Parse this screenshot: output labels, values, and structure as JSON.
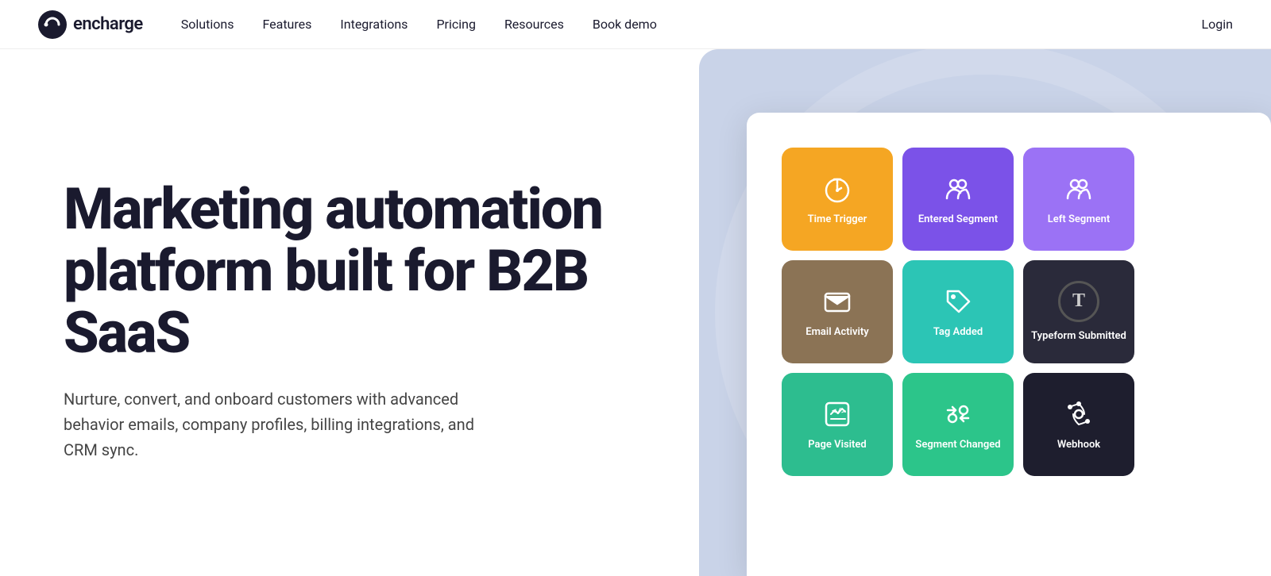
{
  "nav": {
    "logo_text": "encharge",
    "links": [
      {
        "label": "Solutions",
        "id": "solutions"
      },
      {
        "label": "Features",
        "id": "features"
      },
      {
        "label": "Integrations",
        "id": "integrations"
      },
      {
        "label": "Pricing",
        "id": "pricing"
      },
      {
        "label": "Resources",
        "id": "resources"
      },
      {
        "label": "Book demo",
        "id": "book-demo"
      }
    ],
    "login_label": "Login"
  },
  "hero": {
    "heading": "Marketing automation platform built for B2B SaaS",
    "subtext": "Nurture, convert, and onboard customers with advanced behavior emails, company profiles, billing integrations, and CRM sync."
  },
  "tiles": [
    {
      "label": "Time Trigger",
      "color": "orange",
      "icon": "timer"
    },
    {
      "label": "Entered Segment",
      "color": "purple",
      "icon": "users"
    },
    {
      "label": "Left Segment",
      "color": "purple-light",
      "icon": "users"
    },
    {
      "label": "Email Activity",
      "color": "brown",
      "icon": "email"
    },
    {
      "label": "Tag Added",
      "color": "teal",
      "icon": "tag"
    },
    {
      "label": "Typeform Submitted",
      "color": "dark",
      "icon": "typeform"
    },
    {
      "label": "Page Visited",
      "color": "green",
      "icon": "code"
    },
    {
      "label": "Segment Changed",
      "color": "green2",
      "icon": "segment"
    },
    {
      "label": "Webhook",
      "color": "dark2",
      "icon": "webhook"
    }
  ],
  "colors": {
    "orange": "#F5A623",
    "purple": "#7B52E8",
    "purple_light": "#9B72F5",
    "brown": "#8B7355",
    "teal": "#2CC5B5",
    "dark": "#2a2a3a",
    "green": "#2DBD8F",
    "green2": "#2CC58A",
    "dark2": "#1e1e2e"
  }
}
